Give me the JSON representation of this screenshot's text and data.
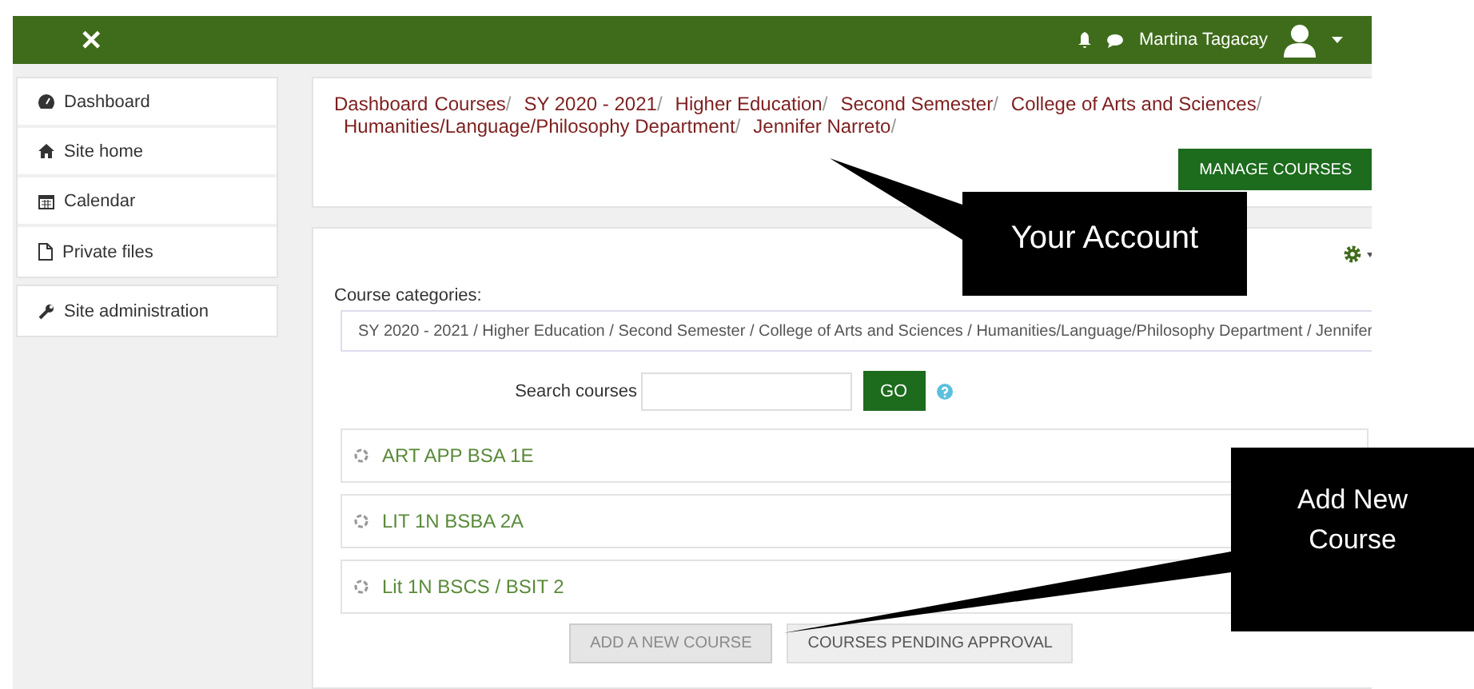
{
  "header": {
    "close_symbol": "✕",
    "user_name": "Martina Tagacay"
  },
  "sidebar": {
    "blocks": [
      [
        {
          "label": "Dashboard"
        },
        {
          "label": "Site home"
        },
        {
          "label": "Calendar"
        },
        {
          "label": "Private files"
        }
      ],
      [
        {
          "label": "Site administration"
        }
      ]
    ]
  },
  "breadcrumb": {
    "lines": [
      [
        {
          "label": "Dashboard"
        },
        {
          "label": "Courses",
          "separator": "/"
        },
        {
          "label": "SY 2020 - 2021",
          "separator": "/"
        },
        {
          "label": "Higher Education",
          "separator": "/"
        },
        {
          "label": "Second Semester",
          "separator": "/"
        },
        {
          "label": "College of Arts and Sciences",
          "separator": "/"
        }
      ],
      [
        {
          "label": "Humanities/Language/Philosophy Department",
          "separator": "/"
        },
        {
          "label": "Jennifer Narreto",
          "separator": "/"
        }
      ]
    ],
    "manage_button": "MANAGE COURSES"
  },
  "categories": {
    "label": "Course categories:",
    "value": "SY 2020 - 2021 / Higher Education / Second Semester / College of Arts and Sciences / Humanities/Language/Philosophy Department / Jennifer"
  },
  "search": {
    "label": "Search courses",
    "button": "GO"
  },
  "courses": [
    {
      "name": "ART APP BSA 1E"
    },
    {
      "name": "LIT 1N BSBA 2A"
    },
    {
      "name": "Lit 1N BSCS / BSIT 2"
    }
  ],
  "buttons": [
    {
      "label": "ADD A NEW COURSE",
      "disabled": true
    },
    {
      "label": "COURSES PENDING APPROVAL",
      "disabled": false
    }
  ],
  "callouts": [
    {
      "text": "Your Account"
    },
    {
      "text": "Add New Course"
    }
  ]
}
